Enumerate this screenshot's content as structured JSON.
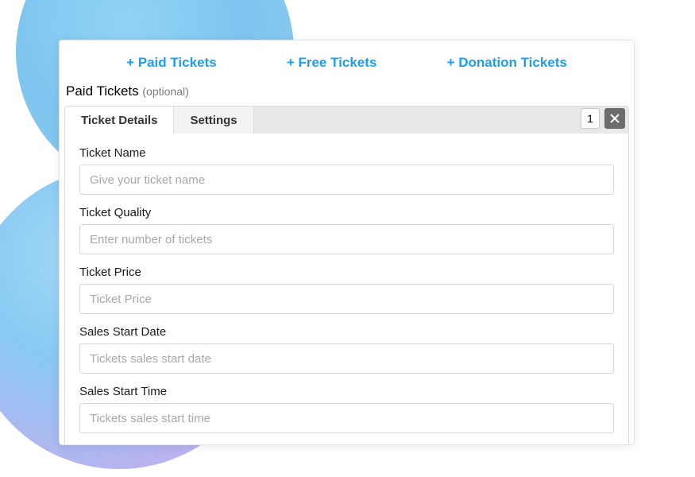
{
  "ticketTypes": {
    "paid": "+ Paid Tickets",
    "free": "+ Free Tickets",
    "donation": "+ Donation Tickets"
  },
  "section": {
    "title": "Paid Tickets",
    "optional": "(optional)"
  },
  "tabs": {
    "details": "Ticket Details",
    "settings": "Settings",
    "counter": "1"
  },
  "fields": {
    "name": {
      "label": "Ticket Name",
      "placeholder": "Give your ticket name"
    },
    "quality": {
      "label": "Ticket Quality",
      "placeholder": "Enter number of tickets"
    },
    "price": {
      "label": "Ticket Price",
      "placeholder": "Ticket Price"
    },
    "startDate": {
      "label": "Sales Start Date",
      "placeholder": "Tickets sales start date"
    },
    "startTime": {
      "label": "Sales Start Time",
      "placeholder": "Tickets sales start time"
    }
  }
}
